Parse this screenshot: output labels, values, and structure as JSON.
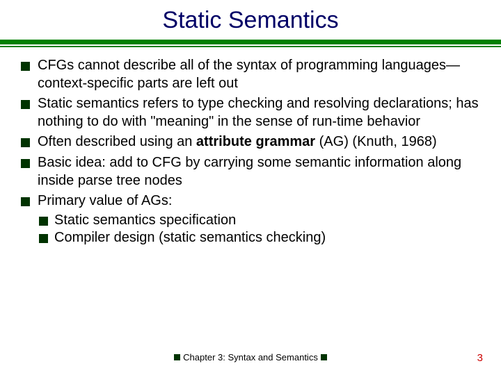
{
  "title": "Static Semantics",
  "bullets": [
    {
      "text": "CFGs cannot describe all of the syntax of programming languages—context-specific parts are left out"
    },
    {
      "text": "Static semantics refers to type checking and resolving declarations; has nothing to do with \"meaning\" in the sense of run-time behavior"
    },
    {
      "pre": "Often described using an ",
      "bold": "attribute grammar",
      "post": " (AG) (Knuth, 1968)"
    },
    {
      "text": "Basic idea: add to CFG by carrying some semantic information along inside parse tree nodes"
    },
    {
      "text": " Primary value of AGs:",
      "sub": [
        "Static semantics specification",
        "Compiler design (static semantics checking)"
      ]
    }
  ],
  "footer": "Chapter 3: Syntax and Semantics",
  "pagenum": "3"
}
